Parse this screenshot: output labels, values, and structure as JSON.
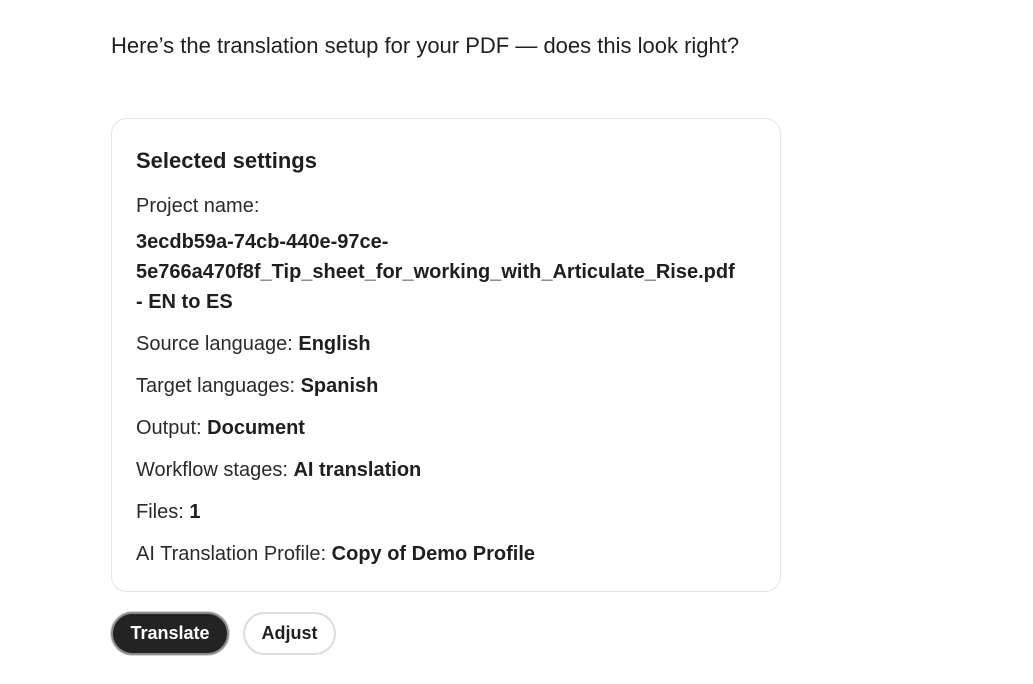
{
  "message": {
    "intro": "Here’s the translation setup for your PDF — does this look right?"
  },
  "settings": {
    "title": "Selected settings",
    "project_name_label": "Project name:",
    "project_name_line1": "3ecdb59a-74cb-440e-97ce-",
    "project_name_line2": "5e766a470f8f_Tip_sheet_for_working_with_Articulate_Rise.pdf",
    "project_name_line3": "- EN to ES",
    "source_language_label": "Source language:",
    "source_language_value": "English",
    "target_languages_label": "Target languages:",
    "target_languages_value": "Spanish",
    "output_label": "Output:",
    "output_value": "Document",
    "workflow_label": "Workflow stages:",
    "workflow_value": "AI translation",
    "files_label": "Files:",
    "files_value": "1",
    "profile_label": "AI Translation Profile:",
    "profile_value": "Copy of Demo Profile"
  },
  "actions": {
    "translate_label": "Translate",
    "adjust_label": "Adjust"
  },
  "colors": {
    "primary_button": "#232323",
    "card_border": "#e4e4e4"
  }
}
